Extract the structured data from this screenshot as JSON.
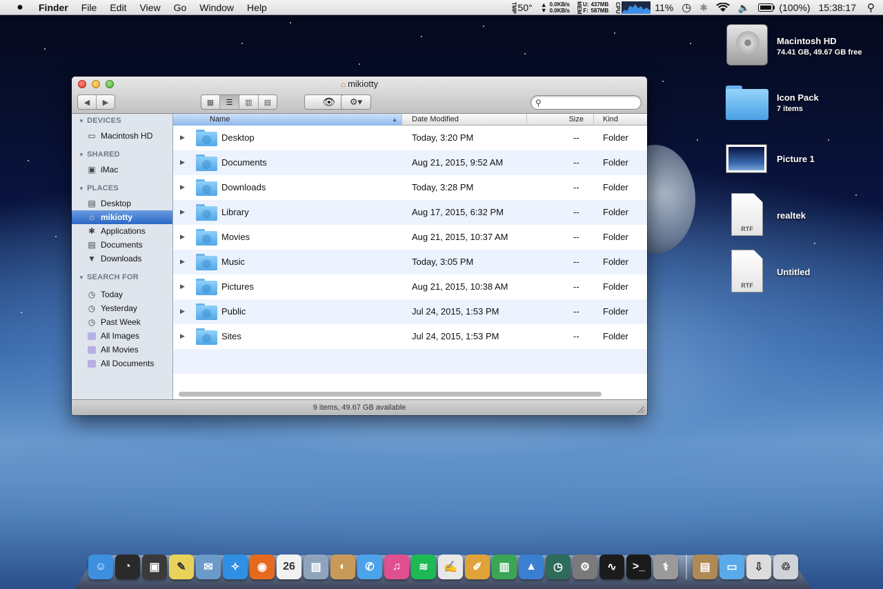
{
  "menubar": {
    "apple": "",
    "items": [
      "Finder",
      "File",
      "Edit",
      "View",
      "Go",
      "Window",
      "Help"
    ],
    "status": {
      "temp_label": "TMP",
      "temp": "50°",
      "net_up": "0.0KB/s",
      "net_down": "0.0KB/s",
      "mem_label": "MEM",
      "mem_used_label": "U:",
      "mem_free_label": "F:",
      "mem_used": "437MB",
      "mem_free": "587MB",
      "cpu_label": "CPU",
      "cpu_percent": "11%",
      "battery": "(100%)",
      "clock": "15:38:17"
    },
    "icons": [
      "time-machine-icon",
      "bluetooth-icon",
      "wifi-icon",
      "volume-icon",
      "battery-icon",
      "spotlight-icon"
    ]
  },
  "window": {
    "title": "mikiotty",
    "nav": {
      "back": "◀",
      "forward": "▶"
    },
    "view_buttons": [
      "▦",
      "☰",
      "▥",
      "▤"
    ],
    "search": {
      "placeholder": "",
      "value": ""
    },
    "sidebar": {
      "sections": [
        {
          "title": "DEVICES",
          "items": [
            {
              "label": "Macintosh HD",
              "icon": "hard-drive-icon"
            }
          ]
        },
        {
          "title": "SHARED",
          "items": [
            {
              "label": "iMac",
              "icon": "imac-icon"
            }
          ]
        },
        {
          "title": "PLACES",
          "items": [
            {
              "label": "Desktop",
              "icon": "desktop-icon"
            },
            {
              "label": "mikiotty",
              "icon": "home-icon",
              "selected": true
            },
            {
              "label": "Applications",
              "icon": "applications-icon"
            },
            {
              "label": "Documents",
              "icon": "documents-icon"
            },
            {
              "label": "Downloads",
              "icon": "downloads-icon"
            }
          ]
        },
        {
          "title": "SEARCH FOR",
          "items": [
            {
              "label": "Today",
              "icon": "clock-icon"
            },
            {
              "label": "Yesterday",
              "icon": "clock-icon"
            },
            {
              "label": "Past Week",
              "icon": "clock-icon"
            },
            {
              "label": "All Images",
              "icon": "smart-folder-icon"
            },
            {
              "label": "All Movies",
              "icon": "smart-folder-icon"
            },
            {
              "label": "All Documents",
              "icon": "smart-folder-icon"
            }
          ]
        }
      ]
    },
    "columns": {
      "name": "Name",
      "date": "Date Modified",
      "size": "Size",
      "kind": "Kind"
    },
    "rows": [
      {
        "name": "Desktop",
        "date": "Today, 3:20 PM",
        "size": "--",
        "kind": "Folder"
      },
      {
        "name": "Documents",
        "date": "Aug 21, 2015, 9:52 AM",
        "size": "--",
        "kind": "Folder"
      },
      {
        "name": "Downloads",
        "date": "Today, 3:28 PM",
        "size": "--",
        "kind": "Folder"
      },
      {
        "name": "Library",
        "date": "Aug 17, 2015, 6:32 PM",
        "size": "--",
        "kind": "Folder"
      },
      {
        "name": "Movies",
        "date": "Aug 21, 2015, 10:37 AM",
        "size": "--",
        "kind": "Folder"
      },
      {
        "name": "Music",
        "date": "Today, 3:05 PM",
        "size": "--",
        "kind": "Folder"
      },
      {
        "name": "Pictures",
        "date": "Aug 21, 2015, 10:38 AM",
        "size": "--",
        "kind": "Folder"
      },
      {
        "name": "Public",
        "date": "Jul 24, 2015, 1:53 PM",
        "size": "--",
        "kind": "Folder"
      },
      {
        "name": "Sites",
        "date": "Jul 24, 2015, 1:53 PM",
        "size": "--",
        "kind": "Folder"
      }
    ],
    "status": "9 items, 49.67 GB available"
  },
  "desktop": [
    {
      "label": "Macintosh HD",
      "sub": "74.41 GB, 49.67 GB free"
    },
    {
      "label": "Icon Pack",
      "sub": "7 items"
    },
    {
      "label": "Picture 1",
      "sub": ""
    },
    {
      "label": "realtek",
      "sub": ""
    },
    {
      "label": "Untitled",
      "sub": ""
    }
  ],
  "dock": [
    {
      "name": "finder",
      "glyph": "☺",
      "color": "#3d8fe0"
    },
    {
      "name": "dashboard",
      "glyph": "◔",
      "color": "#2a2a2a"
    },
    {
      "name": "photo-booth",
      "glyph": "▣",
      "color": "#3a3a3a"
    },
    {
      "name": "stickies",
      "glyph": "✎",
      "color": "#e8d25a"
    },
    {
      "name": "mail",
      "glyph": "✉",
      "color": "#6c9ac9"
    },
    {
      "name": "safari",
      "glyph": "✧",
      "color": "#2f8fe3"
    },
    {
      "name": "firefox",
      "glyph": "◉",
      "color": "#e56a1f"
    },
    {
      "name": "calendar",
      "glyph": "26",
      "color": "#f2f2f2"
    },
    {
      "name": "preview",
      "glyph": "▨",
      "color": "#8fa4bc"
    },
    {
      "name": "contacts",
      "glyph": "◐",
      "color": "#c89a5a"
    },
    {
      "name": "messages",
      "glyph": "✆",
      "color": "#4ca3ea"
    },
    {
      "name": "itunes",
      "glyph": "♫",
      "color": "#e04f8f"
    },
    {
      "name": "spotify",
      "glyph": "≋",
      "color": "#1db954"
    },
    {
      "name": "textedit",
      "glyph": "✍",
      "color": "#e8e8e8"
    },
    {
      "name": "pages",
      "glyph": "✐",
      "color": "#e0a33a"
    },
    {
      "name": "numbers",
      "glyph": "▥",
      "color": "#3aa655"
    },
    {
      "name": "keynote",
      "glyph": "▲",
      "color": "#3a7fd1"
    },
    {
      "name": "time-machine",
      "glyph": "◷",
      "color": "#2e6b5a"
    },
    {
      "name": "system-preferences",
      "glyph": "⚙",
      "color": "#7a7a7a"
    },
    {
      "name": "activity-monitor",
      "glyph": "∿",
      "color": "#1c1c1c"
    },
    {
      "name": "terminal",
      "glyph": ">_",
      "color": "#1a1a1a"
    },
    {
      "name": "disk-utility",
      "glyph": "⚕",
      "color": "#9a9a9a"
    },
    {
      "name": "separator",
      "glyph": "",
      "color": ""
    },
    {
      "name": "applications-stack",
      "glyph": "▤",
      "color": "#b08a55"
    },
    {
      "name": "documents-stack",
      "glyph": "▭",
      "color": "#5aaaea"
    },
    {
      "name": "downloads-stack",
      "glyph": "⇩",
      "color": "#dcdcdc"
    },
    {
      "name": "trash",
      "glyph": "♲",
      "color": "#cfd3d8"
    }
  ]
}
